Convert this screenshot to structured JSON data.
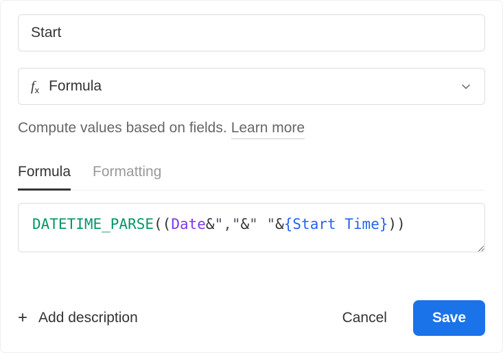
{
  "field_name_input": {
    "value": "Start",
    "placeholder": ""
  },
  "field_type": {
    "label": "Formula"
  },
  "description_text": "Compute values based on fields.",
  "learn_more_label": "Learn more",
  "tabs": {
    "formula": "Formula",
    "formatting": "Formatting"
  },
  "formula": {
    "tokens": {
      "func": "DATETIME_PARSE",
      "open1": "(",
      "open2": "(",
      "field1": "Date",
      "amp1": "&",
      "str1": "\",\"",
      "amp2": "&",
      "str2": "\" \"",
      "amp3": "&",
      "braceOpen": "{",
      "field2": "Start Time",
      "braceClose": "}",
      "close1": ")",
      "close2": ")"
    }
  },
  "footer": {
    "add_description": "Add description",
    "cancel": "Cancel",
    "save": "Save"
  }
}
